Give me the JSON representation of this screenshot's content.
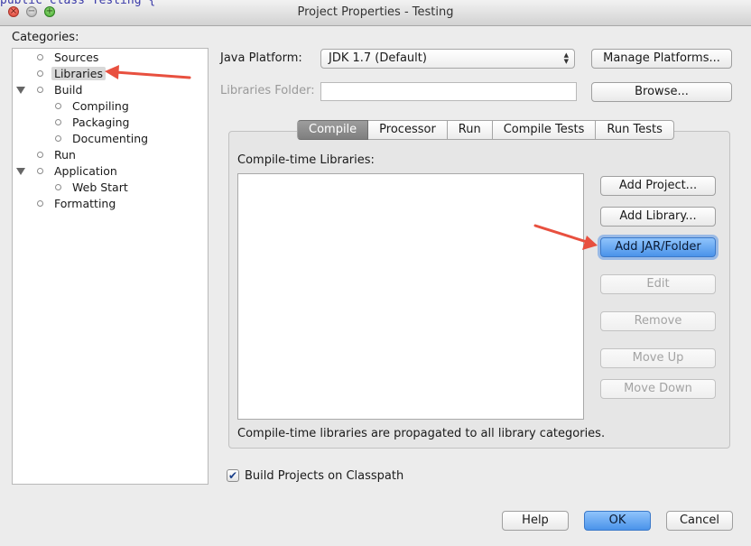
{
  "window": {
    "title": "Project Properties - Testing",
    "background_code": "public class Testing {",
    "close_glyph": "×",
    "min_glyph": "−",
    "zoom_glyph": "+"
  },
  "categories": {
    "label": "Categories:",
    "items": [
      {
        "label": "Sources"
      },
      {
        "label": "Libraries",
        "selected": true
      },
      {
        "label": "Build",
        "expanded": true
      },
      {
        "label": "Compiling"
      },
      {
        "label": "Packaging"
      },
      {
        "label": "Documenting"
      },
      {
        "label": "Run"
      },
      {
        "label": "Application",
        "expanded": true
      },
      {
        "label": "Web Start"
      },
      {
        "label": "Formatting"
      }
    ]
  },
  "java_platform": {
    "label": "Java Platform:",
    "value": "JDK 1.7 (Default)",
    "manage_button": "Manage Platforms..."
  },
  "libraries_folder": {
    "label": "Libraries Folder:",
    "value": "",
    "browse_button": "Browse..."
  },
  "tabs": [
    {
      "label": "Compile",
      "active": true
    },
    {
      "label": "Processor"
    },
    {
      "label": "Run"
    },
    {
      "label": "Compile Tests"
    },
    {
      "label": "Run Tests"
    }
  ],
  "compile_panel": {
    "list_label": "Compile-time Libraries:",
    "note": "Compile-time libraries are propagated to all library categories.",
    "buttons": {
      "add_project": "Add Project...",
      "add_library": "Add Library...",
      "add_jar_folder": "Add JAR/Folder",
      "edit": "Edit",
      "remove": "Remove",
      "move_up": "Move Up",
      "move_down": "Move Down"
    }
  },
  "build_on_classpath": {
    "label": "Build Projects on Classpath",
    "checked": true,
    "check_glyph": "✔"
  },
  "footer": {
    "help": "Help",
    "ok": "OK",
    "cancel": "Cancel"
  },
  "colors": {
    "accent_blue": "#4a93ea",
    "annotation_red": "#e8503f",
    "window_bg": "#ececec"
  }
}
